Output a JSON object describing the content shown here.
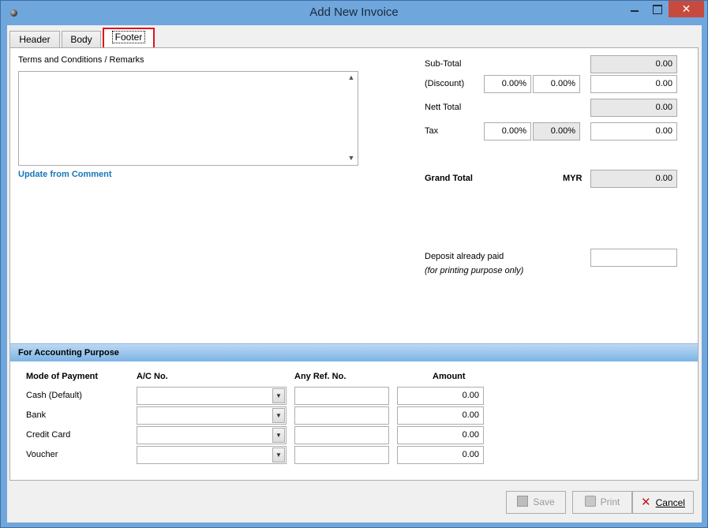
{
  "window": {
    "title": "Add New Invoice",
    "close_glyph": "✕"
  },
  "tabs": [
    "Header",
    "Body",
    "Footer"
  ],
  "footer": {
    "terms_label": "Terms and Conditions / Remarks",
    "update_link": "Update from Comment",
    "sub_total_label": "Sub-Total",
    "sub_total": "0.00",
    "discount_label": "(Discount)",
    "discount_pct1": "0.00%",
    "discount_pct2": "0.00%",
    "discount_value": "0.00",
    "nett_total_label": "Nett Total",
    "nett_total": "0.00",
    "tax_label": "Tax",
    "tax_pct1": "0.00%",
    "tax_pct2": "0.00%",
    "tax_value": "0.00",
    "grand_total_label": "Grand Total",
    "currency": "MYR",
    "grand_total": "0.00",
    "deposit_label": "Deposit already paid",
    "deposit_note": "(for printing purpose only)",
    "deposit_value": ""
  },
  "accounting": {
    "section_title": "For Accounting Purpose",
    "columns": [
      "Mode of Payment",
      "A/C No.",
      "Any Ref. No.",
      "Amount"
    ],
    "rows": [
      {
        "mode": "Cash (Default)",
        "amount": "0.00"
      },
      {
        "mode": "Bank",
        "amount": "0.00"
      },
      {
        "mode": "Credit Card",
        "amount": "0.00"
      },
      {
        "mode": "Voucher",
        "amount": "0.00"
      }
    ]
  },
  "buttons": {
    "save": "Save",
    "print": "Print",
    "cancel": "Cancel"
  }
}
